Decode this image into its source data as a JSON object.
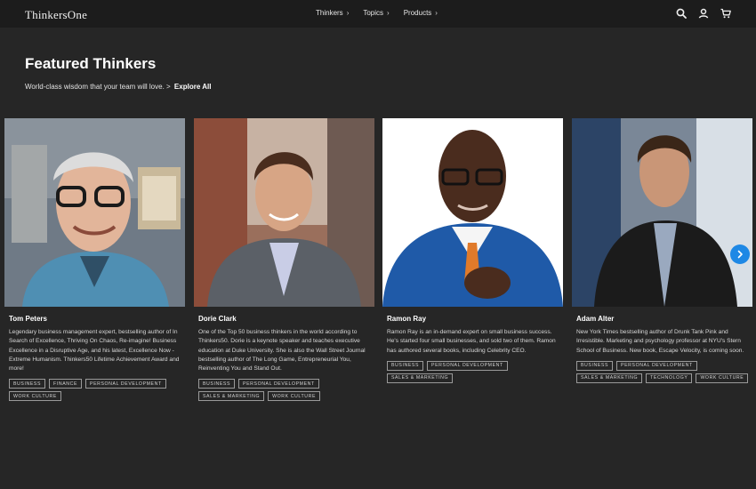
{
  "header": {
    "logo": "ThinkersOne",
    "nav": [
      {
        "label": "Thinkers",
        "chevron": "›"
      },
      {
        "label": "Topics",
        "chevron": "›"
      },
      {
        "label": "Products",
        "chevron": "›"
      }
    ],
    "icons": [
      "search-icon",
      "user-icon",
      "cart-icon"
    ]
  },
  "hero": {
    "title": "Featured Thinkers",
    "subtitle": "World-class wisdom that your team will love. >",
    "link": "Explore All"
  },
  "thinkers": [
    {
      "name": "Tom Peters",
      "bio": "Legendary business management expert, bestselling author of In Search of Excellence, Thriving On Chaos, Re-imagine! Business Excellence in a Disruptive Age, and his latest, Excellence Now - Extreme Humanism. Thinkers50 Lifetime Achievement Award and more!",
      "tags": [
        "Business",
        "Finance",
        "Personal Development",
        "Work Culture"
      ]
    },
    {
      "name": "Dorie Clark",
      "bio": "One of the Top 50 business thinkers in the world according to Thinkers50. Dorie is a keynote speaker and teaches executive education at Duke University. She is also the Wall Street Journal bestselling author of The Long Game, Entrepreneurial You, Reinventing You and Stand Out.",
      "tags": [
        "Business",
        "Personal Development",
        "Sales & Marketing",
        "Work Culture"
      ]
    },
    {
      "name": "Ramon Ray",
      "bio": "Ramon Ray is an in-demand expert on small business success. He's started four small businesses, and sold two of them. Ramon has authored several books, including Celebrity CEO.",
      "tags": [
        "Business",
        "Personal Development",
        "Sales & Marketing"
      ]
    },
    {
      "name": "Adam Alter",
      "bio": "New York Times bestselling author of Drunk Tank Pink and Irresistible. Marketing and psychology professor at NYU's Stern School of Business. New book, Escape Velocity, is coming soon.",
      "tags": [
        "Business",
        "Personal Development",
        "Sales & Marketing",
        "Technology",
        "Work Culture"
      ]
    }
  ],
  "carousel": {
    "next_icon": "chevron-right-icon"
  },
  "colors": {
    "background": "#262626",
    "header": "#1c1c1c",
    "accent": "#1e88e5"
  }
}
